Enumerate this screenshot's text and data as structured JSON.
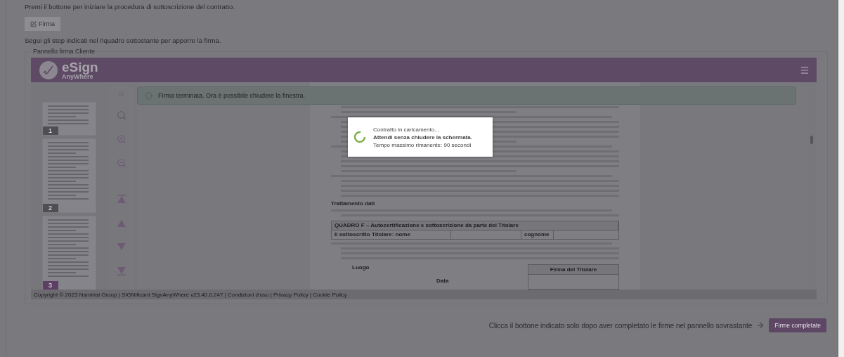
{
  "intro_text": "Premi il bottone per iniziare la procedura di sottoscrizione del contratto.",
  "sign_button": {
    "label": "Firma",
    "disabled": true
  },
  "instruction_text": "Segui gli step indicati nel riquadro sottostante per apporre la firma.",
  "panel": {
    "legend": "Pannello firma Cliente",
    "app": {
      "logo_title": "eSign",
      "logo_subtitle": "AnyWhere",
      "thumbnails": [
        {
          "page": "1",
          "selected": false
        },
        {
          "page": "2",
          "selected": false
        },
        {
          "page": "3",
          "selected": true
        }
      ],
      "alert": "Firma terminata. Ora è possibile chiudere la finestra.",
      "document": {
        "section_heading": "Trattamento dati",
        "table_title": "QUADRO F – Autocertificazione e sottoscrizione da parte del Titolare",
        "name_label": "Il sottoscritto Titolare: nome",
        "surname_label": "cognome",
        "place_label": "Luogo",
        "date_label": "Data",
        "signature_title": "Firma del Titolare"
      },
      "loading": {
        "line_1": "Contratto in caricamento...",
        "line_2": "Attendi senza chiudere la schermata.",
        "line_3": "Tempo massimo rimanente: 90 secondi"
      },
      "footer": "Copyright © 2023 Namirial Group | SIGNificant SignAnyWhere v23.40.0.247 | Condizioni d'uso | Privacy Policy | Cookie Policy"
    }
  },
  "bottom": {
    "hint": "Clicca il bottone indicato solo dopo aver completato le firme nel pannello sovrastante",
    "button": "Firme completate"
  }
}
